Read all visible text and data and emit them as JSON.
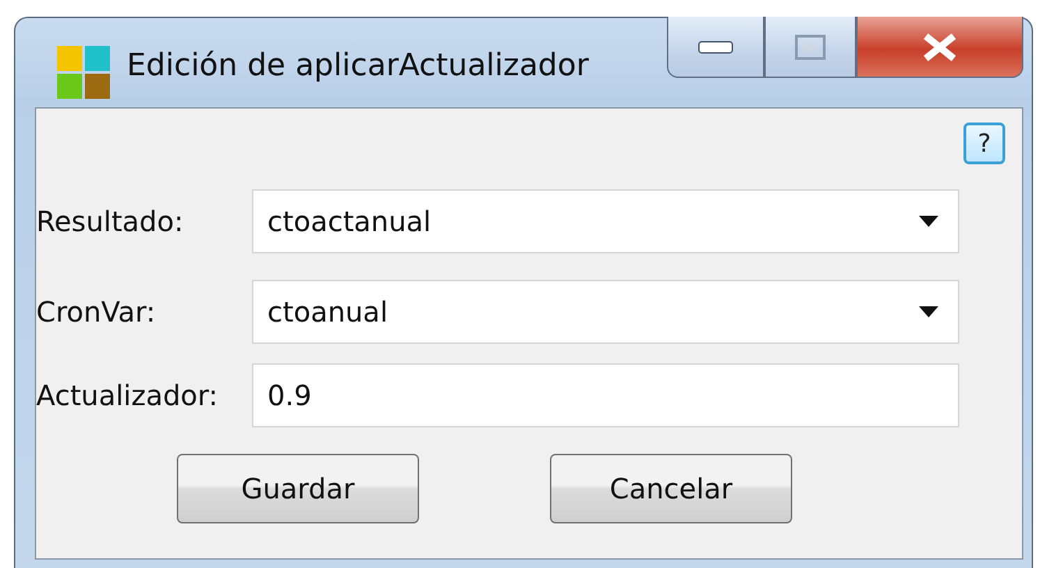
{
  "window": {
    "title": "Edición de aplicarActualizador"
  },
  "help_button": {
    "label": "?"
  },
  "fields": [
    {
      "kind": "dropdown",
      "label": "Resultado:",
      "value": "ctoactanual"
    },
    {
      "kind": "dropdown",
      "label": "CronVar:",
      "value": "ctoanual"
    },
    {
      "kind": "text",
      "label": "Actualizador:",
      "value": "0.9"
    }
  ],
  "buttons": [
    "Guardar",
    "Cancelar"
  ]
}
